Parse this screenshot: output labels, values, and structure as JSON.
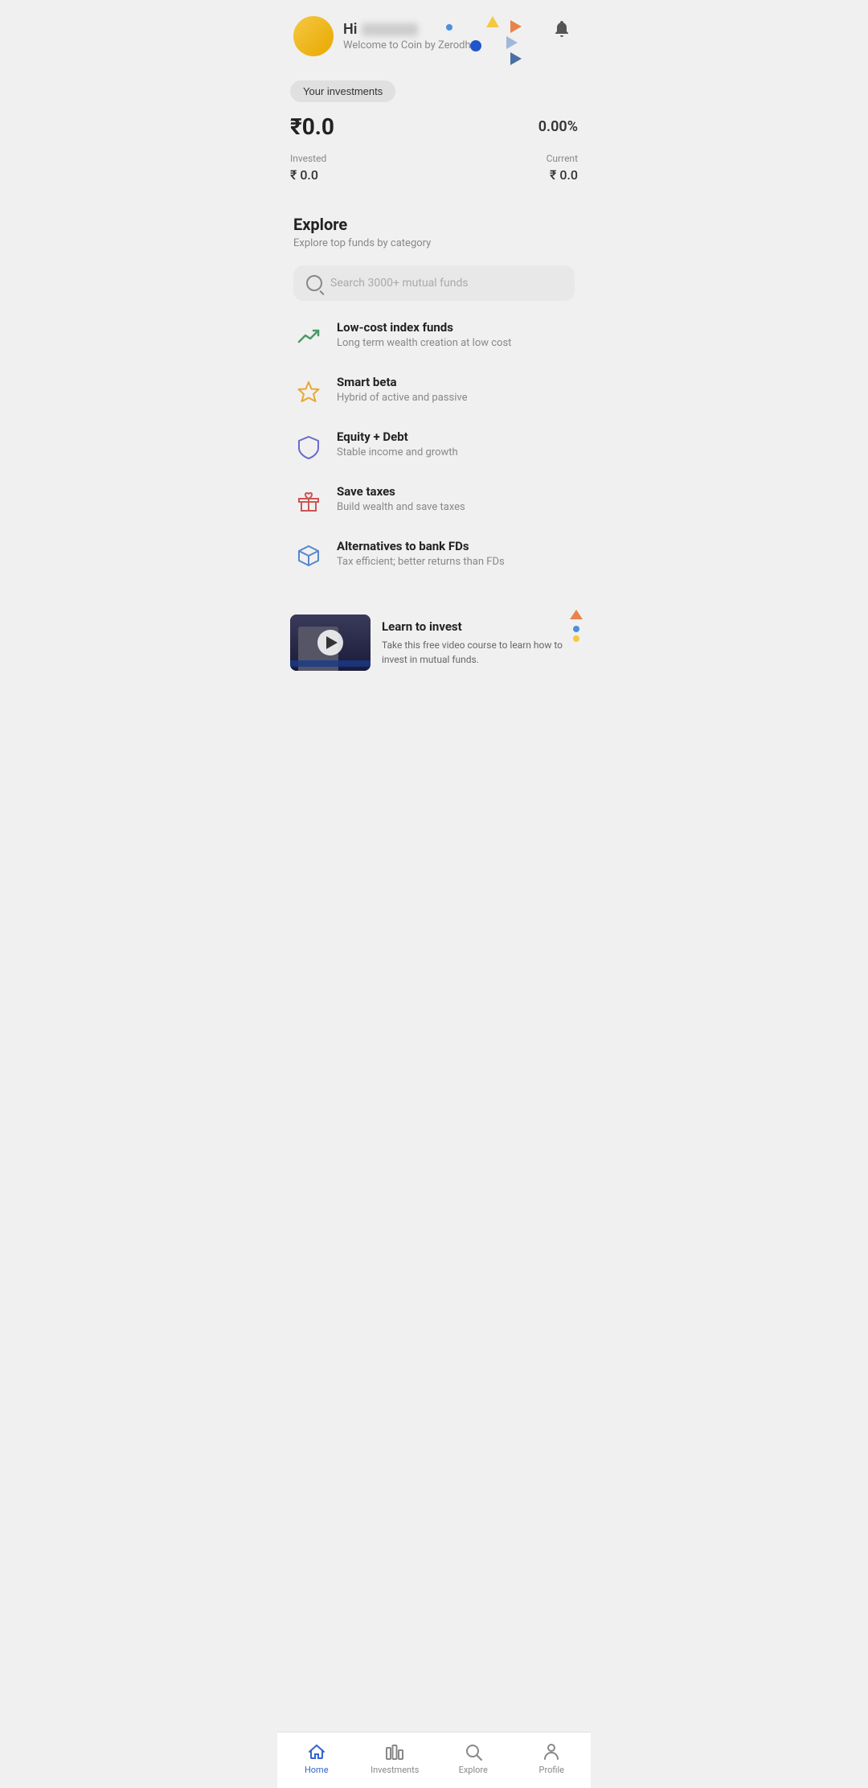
{
  "header": {
    "greeting": "Hi",
    "welcome_text": "Welcome to Coin by Zerodha"
  },
  "investments": {
    "button_label": "Your investments",
    "portfolio_value": "₹0.0",
    "portfolio_percent": "0.00%",
    "invested_label": "Invested",
    "invested_value": "₹ 0.0",
    "current_label": "Current",
    "current_value": "₹ 0.0"
  },
  "explore": {
    "title": "Explore",
    "subtitle": "Explore top funds by category",
    "search_placeholder": "Search 3000+ mutual funds",
    "categories": [
      {
        "id": "low-cost-index",
        "name": "Low-cost index funds",
        "description": "Long term wealth creation at low cost",
        "icon": "trend-up"
      },
      {
        "id": "smart-beta",
        "name": "Smart beta",
        "description": "Hybrid of active and passive",
        "icon": "star"
      },
      {
        "id": "equity-debt",
        "name": "Equity + Debt",
        "description": "Stable income and growth",
        "icon": "shield"
      },
      {
        "id": "save-taxes",
        "name": "Save taxes",
        "description": "Build wealth and save taxes",
        "icon": "gift"
      },
      {
        "id": "alternatives-fd",
        "name": "Alternatives to bank FDs",
        "description": "Tax efficient; better returns than FDs",
        "icon": "box"
      }
    ]
  },
  "learn_banner": {
    "title": "Learn to invest",
    "description": "Take this free video course to learn how to invest in mutual funds."
  },
  "bottom_nav": {
    "items": [
      {
        "id": "home",
        "label": "Home",
        "active": true
      },
      {
        "id": "investments",
        "label": "Investments",
        "active": false
      },
      {
        "id": "explore",
        "label": "Explore",
        "active": false
      },
      {
        "id": "profile",
        "label": "Profile",
        "active": false
      }
    ]
  }
}
